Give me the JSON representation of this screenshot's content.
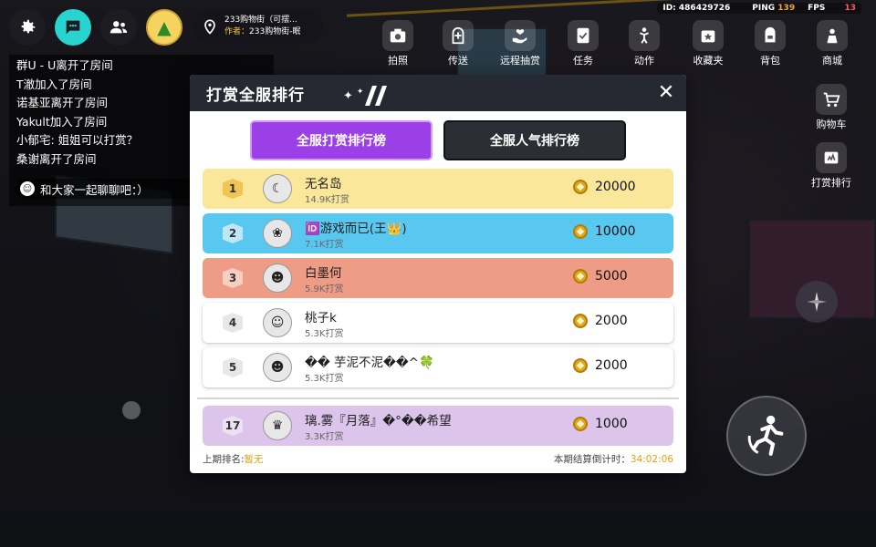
{
  "hud": {
    "id_label": "ID:",
    "id_value": "486429726",
    "ping_label": "PING",
    "ping_value": "139",
    "fps_label": "FPS",
    "fps_value": "13"
  },
  "location": {
    "title": "233购物街（可摆...",
    "author_label": "作者：",
    "author_value": "233购物街-眠"
  },
  "toolbar": {
    "items": [
      {
        "label": "拍照",
        "icon": "camera-icon"
      },
      {
        "label": "传送",
        "icon": "teleport-icon"
      },
      {
        "label": "远程抽赏",
        "icon": "gift-hand-icon"
      },
      {
        "label": "任务",
        "icon": "task-icon"
      },
      {
        "label": "动作",
        "icon": "dance-icon"
      },
      {
        "label": "收藏夹",
        "icon": "favorites-icon"
      },
      {
        "label": "背包",
        "icon": "backpack-icon"
      },
      {
        "label": "商城",
        "icon": "shop-icon"
      }
    ],
    "side": [
      {
        "label": "购物车",
        "icon": "cart-icon"
      },
      {
        "label": "打赏排行",
        "icon": "reward-rank-icon"
      }
    ]
  },
  "chat": {
    "lines": [
      "群U - U离开了房间",
      "T澈加入了房间",
      "诺基亚离开了房间",
      "Yakult加入了房间",
      "小郁宅: 姐姐可以打赏？",
      "桑谢离开了房间"
    ],
    "input_placeholder": "和大家一起聊聊吧：）"
  },
  "modal": {
    "title": "打赏全服排行",
    "close_symbol": "✕",
    "tabs": [
      {
        "label": "全服打赏排行榜",
        "active": true
      },
      {
        "label": "全服人气排行榜",
        "active": false
      }
    ],
    "rows": [
      {
        "rank": "1",
        "name": "无名岛",
        "sub": "14.9K打赏",
        "amount": "20000",
        "bg": "#fbe79a",
        "badge": "#f0c455",
        "avatar": "☾"
      },
      {
        "rank": "2",
        "name": "🆔游戏而已(王👑)",
        "sub": "7.1K打赏",
        "amount": "10000",
        "bg": "#59c8f0",
        "badge": "#bfe6f7",
        "avatar": "❀"
      },
      {
        "rank": "3",
        "name": "白墨何",
        "sub": "5.9K打赏",
        "amount": "5000",
        "bg": "#ee9c85",
        "badge": "#f6cfc2",
        "avatar": "☻"
      },
      {
        "rank": "4",
        "name": "桃子k",
        "sub": "5.3K打赏",
        "amount": "2000",
        "bg": "#ffffff",
        "badge": "#e7e7e7",
        "avatar": "☺"
      },
      {
        "rank": "5",
        "name": "�� 芋泥不泥��^🍀",
        "sub": "5.3K打赏",
        "amount": "2000",
        "bg": "#ffffff",
        "badge": "#e7e7e7",
        "avatar": "☻"
      }
    ],
    "my_row": {
      "rank": "17",
      "name": "璃.雾『月落』�°��希望",
      "sub": "3.3K打赏",
      "amount": "1000",
      "bg": "#dcc4ea",
      "badge": "#ece0f3",
      "avatar": "♛"
    },
    "footer_left_label": "上期排名:",
    "footer_left_value": "暂无",
    "footer_right_label": "本期结算倒计时：",
    "footer_right_value": "34:02:06"
  },
  "colors": {
    "active_tab": "#9b3fe6",
    "chat_button": "#28d4cf",
    "coin": "#e0a81e",
    "highlight": "#e3a010"
  }
}
